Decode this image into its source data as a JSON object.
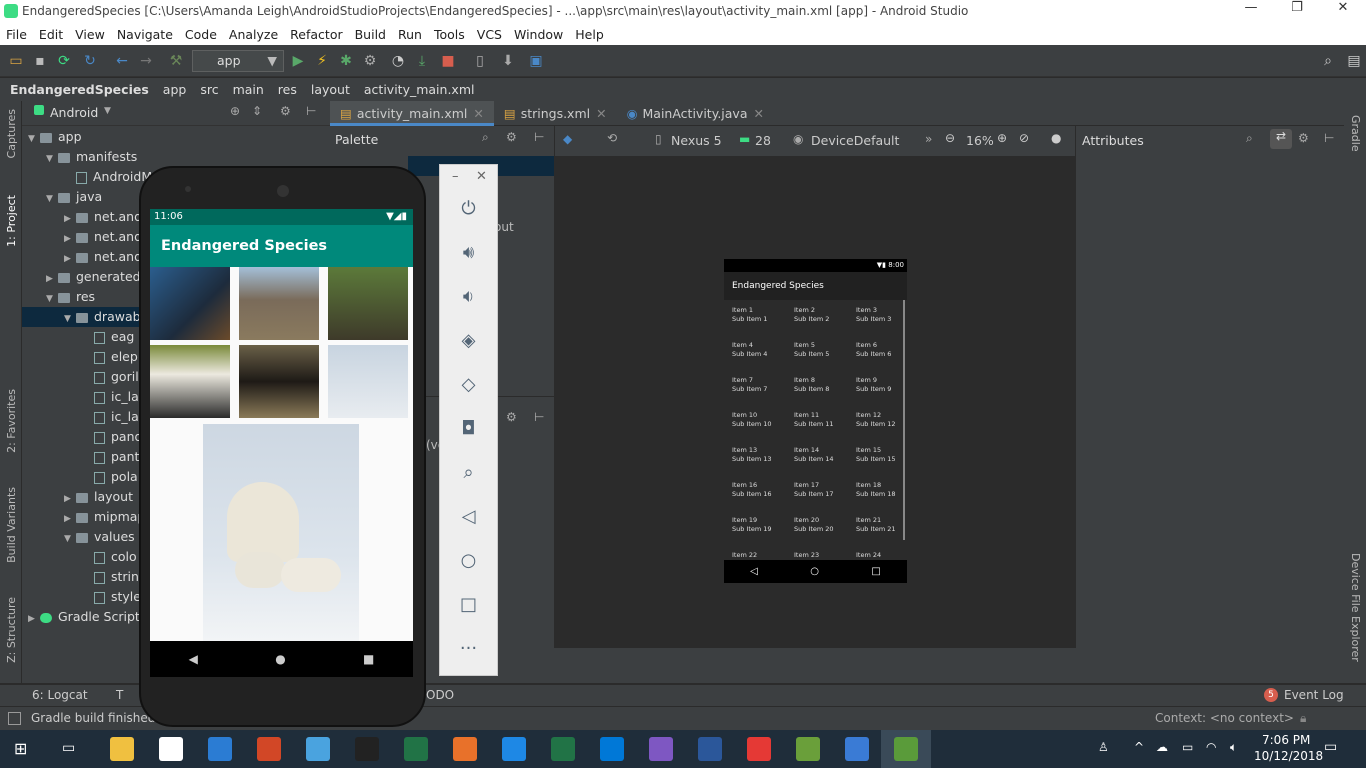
{
  "window": {
    "title": "EndangeredSpecies [C:\\Users\\Amanda Leigh\\AndroidStudioProjects\\EndangeredSpecies] - ...\\app\\src\\main\\res\\layout\\activity_main.xml [app] - Android Studio"
  },
  "menu": [
    "File",
    "Edit",
    "View",
    "Navigate",
    "Code",
    "Analyze",
    "Refactor",
    "Build",
    "Run",
    "Tools",
    "VCS",
    "Window",
    "Help"
  ],
  "toolbar": {
    "run_config": "app"
  },
  "breadcrumbs": [
    "EndangeredSpecies",
    "app",
    "src",
    "main",
    "res",
    "layout",
    "activity_main.xml"
  ],
  "project_panel": {
    "view_selector": "Android",
    "tree": [
      {
        "label": "app",
        "indent": 0,
        "kind": "folder",
        "open": true
      },
      {
        "label": "manifests",
        "indent": 1,
        "kind": "folder",
        "open": true
      },
      {
        "label": "AndroidM",
        "indent": 2,
        "kind": "file"
      },
      {
        "label": "java",
        "indent": 1,
        "kind": "folder",
        "open": true
      },
      {
        "label": "net.and",
        "indent": 2,
        "kind": "folder"
      },
      {
        "label": "net.and",
        "indent": 2,
        "kind": "folder"
      },
      {
        "label": "net.and",
        "indent": 2,
        "kind": "folder"
      },
      {
        "label": "generatedJ",
        "indent": 1,
        "kind": "folder"
      },
      {
        "label": "res",
        "indent": 1,
        "kind": "folder",
        "open": true
      },
      {
        "label": "drawab",
        "indent": 2,
        "kind": "folder",
        "open": true,
        "selected": true
      },
      {
        "label": "eag",
        "indent": 3,
        "kind": "file"
      },
      {
        "label": "elep",
        "indent": 3,
        "kind": "file"
      },
      {
        "label": "goril",
        "indent": 3,
        "kind": "file"
      },
      {
        "label": "ic_la",
        "indent": 3,
        "kind": "file"
      },
      {
        "label": "ic_la",
        "indent": 3,
        "kind": "file"
      },
      {
        "label": "pand",
        "indent": 3,
        "kind": "file"
      },
      {
        "label": "pant",
        "indent": 3,
        "kind": "file"
      },
      {
        "label": "pola",
        "indent": 3,
        "kind": "file"
      },
      {
        "label": "layout",
        "indent": 2,
        "kind": "folder"
      },
      {
        "label": "mipmap",
        "indent": 2,
        "kind": "folder"
      },
      {
        "label": "values",
        "indent": 2,
        "kind": "folder",
        "open": true
      },
      {
        "label": "colo",
        "indent": 3,
        "kind": "file"
      },
      {
        "label": "strin",
        "indent": 3,
        "kind": "file"
      },
      {
        "label": "style",
        "indent": 3,
        "kind": "file"
      },
      {
        "label": "Gradle Scripts",
        "indent": 0,
        "kind": "gradle"
      }
    ]
  },
  "side_tabs_left": [
    "Captures",
    "1: Project",
    "2: Favorites",
    "Build Variants",
    "Z: Structure"
  ],
  "side_tabs_right": [
    "Gradle",
    "Device File Explorer"
  ],
  "editor_tabs": [
    {
      "label": "activity_main.xml",
      "active": true
    },
    {
      "label": "strings.xml",
      "active": false
    },
    {
      "label": "MainActivity.java",
      "active": false
    }
  ],
  "palette": {
    "title": "Palette",
    "partial_text_1": "out",
    "partial_text_2": "(ve"
  },
  "design_toolbar": {
    "device": "Nexus 5",
    "api": "28",
    "theme": "DeviceDefault",
    "zoom": "16%"
  },
  "attributes": {
    "title": "Attributes"
  },
  "preview": {
    "status_time": "8:00",
    "app_title": "Endangered Species",
    "items": [
      [
        "Item 1",
        "Sub Item 1"
      ],
      [
        "Item 2",
        "Sub Item 2"
      ],
      [
        "Item 3",
        "Sub Item 3"
      ],
      [
        "Item 4",
        "Sub Item 4"
      ],
      [
        "Item 5",
        "Sub Item 5"
      ],
      [
        "Item 6",
        "Sub Item 6"
      ],
      [
        "Item 7",
        "Sub Item 7"
      ],
      [
        "Item 8",
        "Sub Item 8"
      ],
      [
        "Item 9",
        "Sub Item 9"
      ],
      [
        "Item 10",
        "Sub Item 10"
      ],
      [
        "Item 11",
        "Sub Item 11"
      ],
      [
        "Item 12",
        "Sub Item 12"
      ],
      [
        "Item 13",
        "Sub Item 13"
      ],
      [
        "Item 14",
        "Sub Item 14"
      ],
      [
        "Item 15",
        "Sub Item 15"
      ],
      [
        "Item 16",
        "Sub Item 16"
      ],
      [
        "Item 17",
        "Sub Item 17"
      ],
      [
        "Item 18",
        "Sub Item 18"
      ],
      [
        "Item 19",
        "Sub Item 19"
      ],
      [
        "Item 20",
        "Sub Item 20"
      ],
      [
        "Item 21",
        "Sub Item 21"
      ],
      [
        "Item 22",
        ""
      ],
      [
        "Item 23",
        ""
      ],
      [
        "Item 24",
        ""
      ]
    ]
  },
  "emulator": {
    "time": "11:06",
    "app_title": "Endangered Species",
    "photos": [
      "eagle",
      "elephant",
      "gorilla",
      "panda",
      "panther",
      "polar bear"
    ],
    "large_photo": "polar bear"
  },
  "bottom_tabs": {
    "logcat": "6: Logcat",
    "terminal": "T",
    "todo": "ODO",
    "event_log": "Event Log",
    "event_count": "5"
  },
  "status": {
    "message": "Gradle build finished",
    "context": "Context: <no context>"
  },
  "clock": {
    "time": "7:06 PM",
    "date": "10/12/2018"
  }
}
